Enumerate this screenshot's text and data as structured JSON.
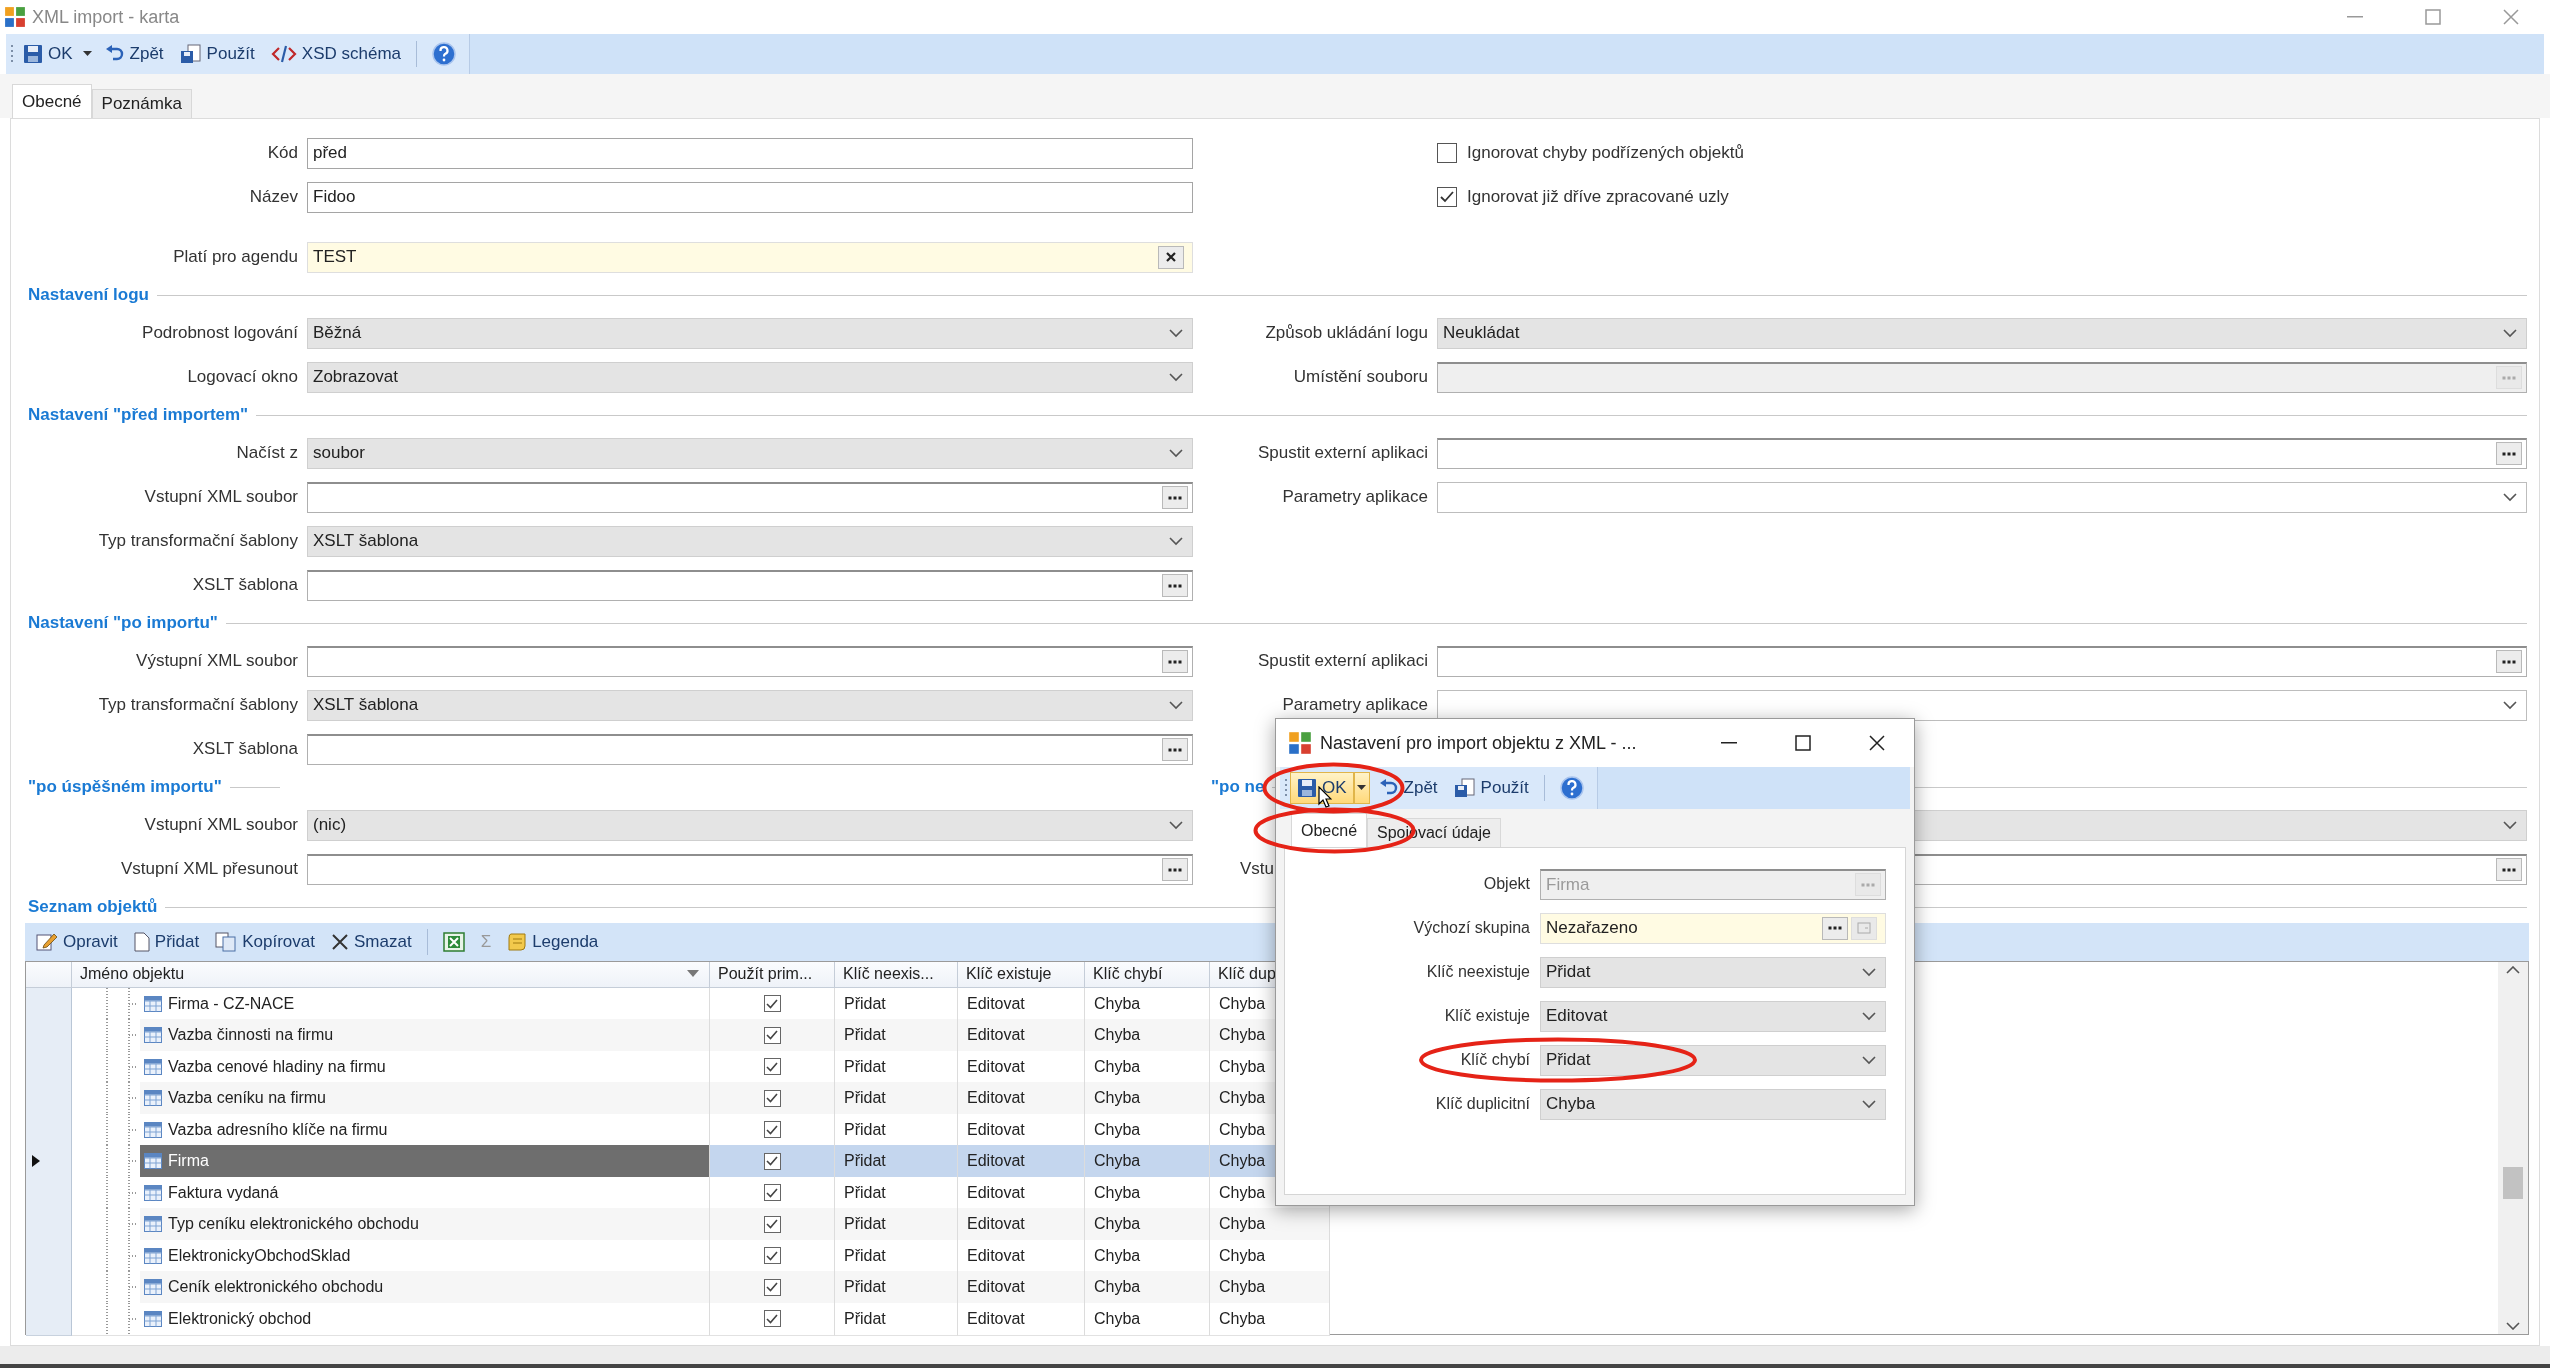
{
  "window": {
    "title": "XML import - karta"
  },
  "toolbar": [
    {
      "kind": "save",
      "label": "OK",
      "dropdown": true
    },
    {
      "kind": "undo",
      "label": "Zpět"
    },
    {
      "kind": "apply",
      "label": "Použít"
    },
    {
      "kind": "schema",
      "label": "XSD schéma"
    },
    {
      "kind": "help"
    }
  ],
  "tabs": [
    {
      "label": "Obecné",
      "selected": true
    },
    {
      "label": "Poznámka",
      "selected": false
    }
  ],
  "sections": [
    {
      "rows": [
        {
          "left": {
            "label": "Kód",
            "kind": "text",
            "value": "před"
          },
          "right": {
            "kind": "checkbox",
            "label": "Ignorovat chyby podřízených objektů",
            "checked": false
          }
        },
        {
          "left": {
            "label": "Název",
            "kind": "text",
            "value": "Fidoo"
          },
          "right": {
            "kind": "checkbox",
            "label": "Ignorovat již dříve zpracované uzly",
            "checked": true
          }
        },
        {
          "left": {
            "label": "Platí pro agendu",
            "kind": "lookup",
            "value": "TEST"
          }
        }
      ]
    },
    {
      "heading": "Nastavení logu",
      "rows": [
        {
          "left": {
            "label": "Podrobnost logování",
            "kind": "select",
            "value": "Běžná"
          },
          "right": {
            "label": "Způsob ukládání logu",
            "kind": "select",
            "value": "Neukládat"
          }
        },
        {
          "left": {
            "label": "Logovací okno",
            "kind": "select",
            "value": "Zobrazovat"
          },
          "right": {
            "label": "Umístění souboru",
            "kind": "browse",
            "disabled": true
          }
        }
      ]
    },
    {
      "heading": "Nastavení \"před importem\"",
      "rows": [
        {
          "left": {
            "label": "Načíst z",
            "kind": "select",
            "value": "soubor"
          },
          "right": {
            "label": "Spustit externí aplikaci",
            "kind": "browse",
            "disabled": false
          }
        },
        {
          "left": {
            "label": "Vstupní XML soubor",
            "kind": "browse",
            "disabled": false
          },
          "right": {
            "label": "Parametry aplikace",
            "kind": "combo"
          }
        },
        {
          "left": {
            "label": "Typ transformační šablony",
            "kind": "select",
            "value": "XSLT šablona"
          }
        },
        {
          "left": {
            "label": "XSLT šablona",
            "kind": "browse",
            "disabled": false
          }
        }
      ]
    },
    {
      "heading": "Nastavení \"po importu\"",
      "rows": [
        {
          "left": {
            "label": "Výstupní XML soubor",
            "kind": "browse",
            "disabled": false
          },
          "right": {
            "label": "Spustit externí aplikaci",
            "kind": "browse",
            "disabled": false
          }
        },
        {
          "left": {
            "label": "Typ transformační šablony",
            "kind": "select",
            "value": "XSLT šablona"
          },
          "right": {
            "label": "Parametry aplikace",
            "kind": "combo"
          }
        },
        {
          "left": {
            "label": "XSLT šablona",
            "kind": "browse",
            "disabled": false
          }
        }
      ]
    },
    {
      "heading": "\"po úspěšném importu\"",
      "right_heading": "\"po ne",
      "rows": [
        {
          "left": {
            "label": "Vstupní XML soubor",
            "kind": "select",
            "value": "(nic)"
          },
          "right": {
            "kind": "select"
          }
        },
        {
          "left": {
            "label": "Vstupní XML přesunout",
            "kind": "browse",
            "disabled": false
          },
          "right": {
            "label": "Vstu",
            "kind": "browse",
            "disabled": false
          }
        }
      ]
    }
  ],
  "objects": {
    "heading": "Seznam objektů",
    "toolbar": [
      {
        "kind": "edit",
        "label": "Opravit"
      },
      {
        "kind": "new",
        "label": "Přidat"
      },
      {
        "kind": "copy",
        "label": "Kopírovat"
      },
      {
        "kind": "delete",
        "label": "Smazat"
      },
      {
        "kind": "excel"
      },
      {
        "kind": "sum",
        "label": "Σ"
      },
      {
        "kind": "legend",
        "label": "Legenda"
      }
    ],
    "columns": [
      "Jméno objektu",
      "Použít prim...",
      "Klíč neexis...",
      "Klíč existuje",
      "Klíč chybí",
      "Klíč dup"
    ],
    "rows": [
      {
        "cells": [
          {
            "text": "Firma - CZ-NACE"
          },
          {
            "checked": true
          },
          {
            "text": "Přidat"
          },
          {
            "text": "Editovat"
          },
          {
            "text": "Chyba"
          },
          {
            "text": "Chyba"
          }
        ],
        "selected": false
      },
      {
        "cells": [
          {
            "text": "Vazba činnosti na firmu"
          },
          {
            "checked": true
          },
          {
            "text": "Přidat"
          },
          {
            "text": "Editovat"
          },
          {
            "text": "Chyba"
          },
          {
            "text": "Chyba"
          }
        ],
        "selected": false
      },
      {
        "cells": [
          {
            "text": "Vazba cenové hladiny na firmu"
          },
          {
            "checked": true
          },
          {
            "text": "Přidat"
          },
          {
            "text": "Editovat"
          },
          {
            "text": "Chyba"
          },
          {
            "text": "Chyba"
          }
        ],
        "selected": false
      },
      {
        "cells": [
          {
            "text": "Vazba ceníku na firmu"
          },
          {
            "checked": true
          },
          {
            "text": "Přidat"
          },
          {
            "text": "Editovat"
          },
          {
            "text": "Chyba"
          },
          {
            "text": "Chyba"
          }
        ],
        "selected": false
      },
      {
        "cells": [
          {
            "text": "Vazba adresního klíče na firmu"
          },
          {
            "checked": true
          },
          {
            "text": "Přidat"
          },
          {
            "text": "Editovat"
          },
          {
            "text": "Chyba"
          },
          {
            "text": "Chyba"
          }
        ],
        "selected": false
      },
      {
        "cells": [
          {
            "text": "Firma"
          },
          {
            "checked": true
          },
          {
            "text": "Přidat"
          },
          {
            "text": "Editovat"
          },
          {
            "text": "Chyba"
          },
          {
            "text": "Chyba"
          }
        ],
        "selected": true
      },
      {
        "cells": [
          {
            "text": "Faktura vydaná"
          },
          {
            "checked": true
          },
          {
            "text": "Přidat"
          },
          {
            "text": "Editovat"
          },
          {
            "text": "Chyba"
          },
          {
            "text": "Chyba"
          }
        ],
        "selected": false
      },
      {
        "cells": [
          {
            "text": "Typ ceníku elektronického obchodu"
          },
          {
            "checked": true
          },
          {
            "text": "Přidat"
          },
          {
            "text": "Editovat"
          },
          {
            "text": "Chyba"
          },
          {
            "text": "Chyba"
          }
        ],
        "selected": false
      },
      {
        "cells": [
          {
            "text": "ElektronickyObchodSklad"
          },
          {
            "checked": true
          },
          {
            "text": "Přidat"
          },
          {
            "text": "Editovat"
          },
          {
            "text": "Chyba"
          },
          {
            "text": "Chyba"
          }
        ],
        "selected": false
      },
      {
        "cells": [
          {
            "text": "Ceník elektronického obchodu"
          },
          {
            "checked": true
          },
          {
            "text": "Přidat"
          },
          {
            "text": "Editovat"
          },
          {
            "text": "Chyba"
          },
          {
            "text": "Chyba"
          }
        ],
        "selected": false
      },
      {
        "cells": [
          {
            "text": "Elektronický obchod"
          },
          {
            "checked": true
          },
          {
            "text": "Přidat"
          },
          {
            "text": "Editovat"
          },
          {
            "text": "Chyba"
          },
          {
            "text": "Chyba"
          }
        ],
        "selected": false
      }
    ]
  },
  "dialog": {
    "title": "Nastavení pro import objektu z XML - ...",
    "toolbar": [
      {
        "kind": "save",
        "label": "OK",
        "dropdown": true,
        "hovered": true,
        "annotated": true
      },
      {
        "kind": "undo",
        "label": "Zpět"
      },
      {
        "kind": "apply",
        "label": "Použít"
      },
      {
        "kind": "help"
      }
    ],
    "tabs": [
      {
        "label": "Obecné",
        "selected": true,
        "annotated": true
      },
      {
        "label": "Spojovací údaje",
        "selected": false
      }
    ],
    "fields": [
      {
        "label": "Objekt",
        "kind": "browse",
        "value": "Firma",
        "disabled": true
      },
      {
        "label": "Výchozí skupina",
        "kind": "picker",
        "value": "Nezařazeno"
      },
      {
        "label": "Klíč neexistuje",
        "kind": "select",
        "value": "Přidat"
      },
      {
        "label": "Klíč existuje",
        "kind": "select",
        "value": "Editovat"
      },
      {
        "label": "Klíč chybí",
        "kind": "select",
        "value": "Přidat",
        "annotated": true
      },
      {
        "label": "Klíč duplicitní",
        "kind": "select",
        "value": "Chyba"
      }
    ]
  }
}
